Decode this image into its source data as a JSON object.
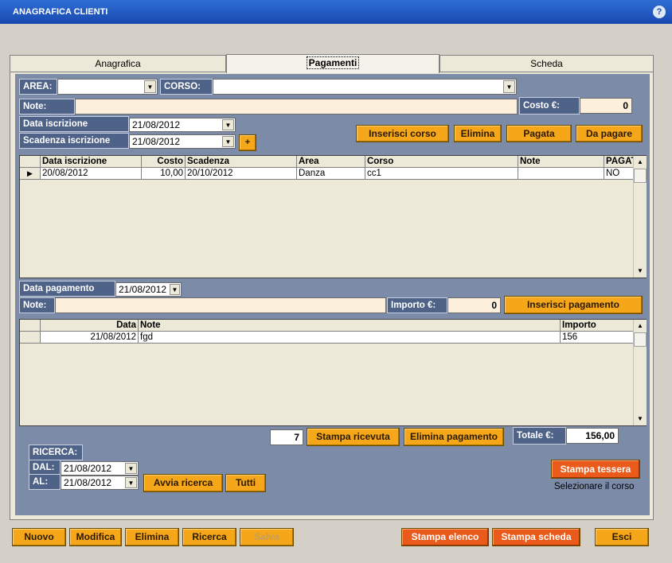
{
  "window": {
    "title": "ANAGRAFICA CLIENTI",
    "help": "?"
  },
  "tabs": [
    "Anagrafica",
    "Pagamenti",
    "Scheda"
  ],
  "form": {
    "area_label": "AREA:",
    "area_value": "",
    "corso_label": "CORSO:",
    "corso_value": "",
    "note_label": "Note:",
    "note_value": "",
    "costo_label": "Costo €:",
    "costo_value": "0",
    "data_iscrizione_label": "Data iscrizione",
    "data_iscrizione_value": "21/08/2012",
    "scadenza_label": "Scadenza iscrizione",
    "scadenza_value": "21/08/2012",
    "plus_label": "+"
  },
  "course_buttons": {
    "inserisci": "Inserisci corso",
    "elimina": "Elimina",
    "pagata": "Pagata",
    "da_pagare": "Da pagare"
  },
  "courses_table": {
    "headers": [
      "Data iscrizione",
      "Costo",
      "Scadenza",
      "Area",
      "Corso",
      "Note",
      "PAGATO"
    ],
    "rows": [
      [
        "20/08/2012",
        "10,00",
        "20/10/2012",
        "Danza",
        "cc1",
        "",
        "NO"
      ]
    ]
  },
  "payment": {
    "data_label": "Data pagamento",
    "data_value": "21/08/2012",
    "note_label": "Note:",
    "note_value": "",
    "importo_label": "Importo €:",
    "importo_value": "0",
    "inserisci_label": "Inserisci pagamento"
  },
  "payments_table": {
    "headers": [
      "Data",
      "Note",
      "Importo"
    ],
    "rows": [
      [
        "21/08/2012",
        "fgd",
        "156"
      ]
    ]
  },
  "receipt": {
    "count": "7",
    "stampa_ricevuta": "Stampa ricevuta",
    "elimina_pagamento": "Elimina pagamento",
    "totale_label": "Totale €:",
    "totale_value": "156,00"
  },
  "search": {
    "title": "RICERCA:",
    "dal_label": "DAL:",
    "dal_value": "21/08/2012",
    "al_label": "AL:",
    "al_value": "21/08/2012",
    "avvia": "Avvia ricerca",
    "tutti": "Tutti"
  },
  "tessera": {
    "button": "Stampa tessera",
    "hint": "Selezionare il corso"
  },
  "bottom_buttons": {
    "nuovo": "Nuovo",
    "modifica": "Modifica",
    "elimina": "Elimina",
    "ricerca": "Ricerca",
    "salva": "Salva",
    "stampa_elenco": "Stampa elenco",
    "stampa_scheda": "Stampa scheda",
    "esci": "Esci"
  },
  "icons": {
    "dropdown": "▼",
    "row_pointer": "▶",
    "scroll_up": "▲",
    "scroll_down": "▼"
  },
  "colors": {
    "panel": "#7b8ba8",
    "label_bg": "#4f6388",
    "button": "#f6a619",
    "button_red": "#ea5a1a",
    "field": "#fcf0dc"
  }
}
